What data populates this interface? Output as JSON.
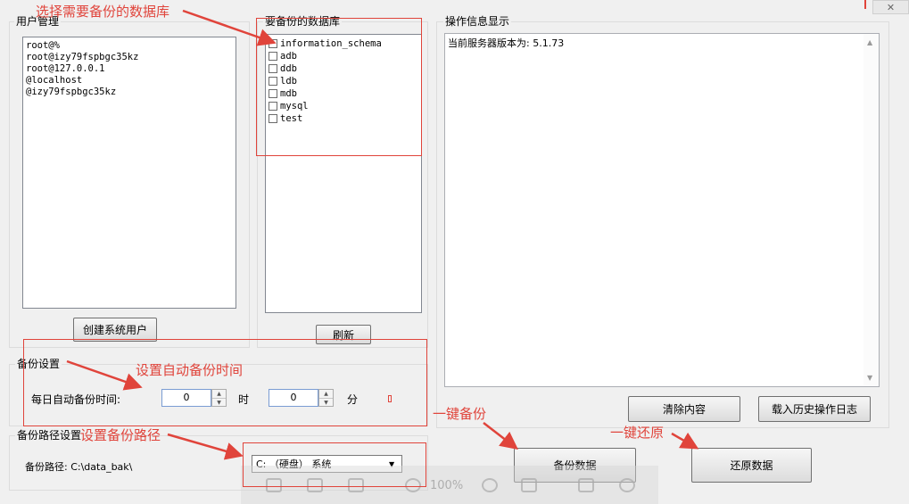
{
  "annotations": {
    "select_db": "选择需要备份的数据库",
    "auto_time": "设置自动备份时间",
    "one_click_backup": "一键备份",
    "backup_path": "设置备份路径",
    "one_click_restore": "一键还原"
  },
  "user_mgmt": {
    "title": "用户管理",
    "users": [
      "root@%",
      "root@izy79fspbgc35kz",
      "root@127.0.0.1",
      "@localhost",
      "@izy79fspbgc35kz"
    ],
    "create_button": "创建系统用户"
  },
  "databases": {
    "title": "要备份的数据库",
    "items": [
      "information_schema",
      "adb",
      "ddb",
      "ldb",
      "mdb",
      "mysql",
      "test"
    ],
    "refresh_button": "刷新"
  },
  "ops_log": {
    "title": "操作信息显示",
    "text": "当前服务器版本为: 5.1.73",
    "clear_button": "清除内容",
    "load_history_button": "载入历史操作日志"
  },
  "backup_settings": {
    "title": "备份设置",
    "daily_label": "每日自动备份时间:",
    "hour_value": "0",
    "hour_unit": "时",
    "minute_value": "0",
    "minute_unit": "分"
  },
  "path_settings": {
    "title": "备份路径设置",
    "path_label": "备份路径: C:\\data_bak\\",
    "drive_value": "C: （硬盘） 系统"
  },
  "actions": {
    "backup_button": "备份数据",
    "restore_button": "还原数据"
  },
  "viewer_toolbar": {
    "zoom": "100%"
  },
  "colors": {
    "annotation_red": "#e0443b",
    "window_bg": "#f0f0f0"
  }
}
